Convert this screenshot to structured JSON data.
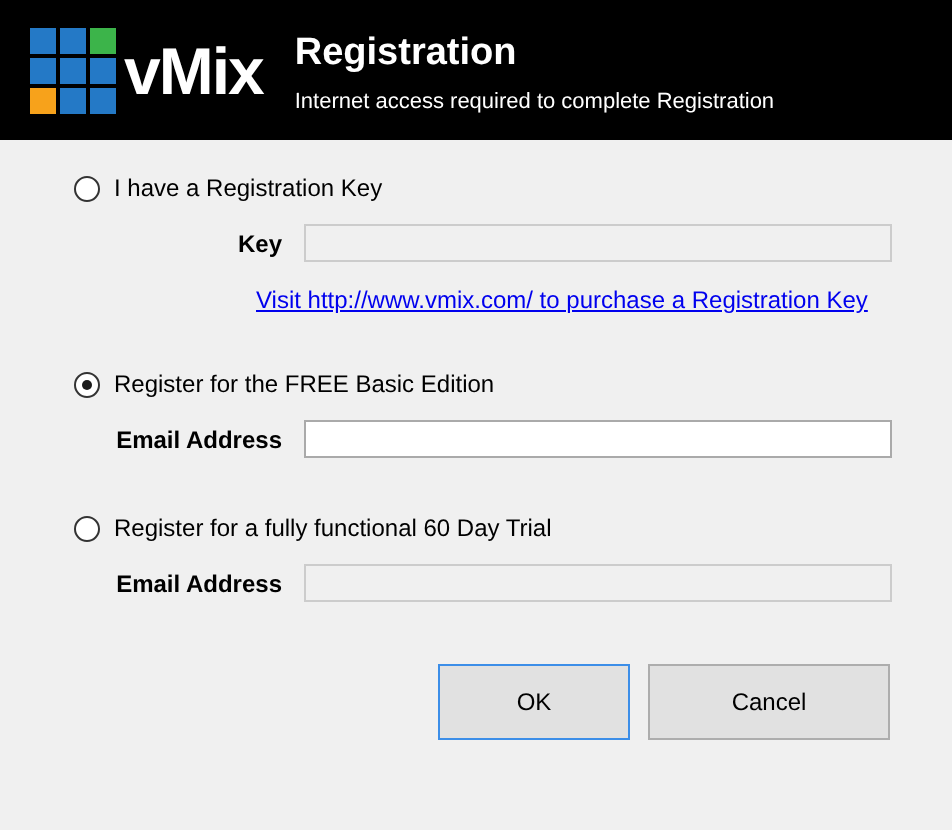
{
  "header": {
    "logo_text": "vMix",
    "title": "Registration",
    "subtitle": "Internet access required to complete Registration"
  },
  "options": [
    {
      "label": "I have a Registration Key",
      "selected": false,
      "field": {
        "label": "Key",
        "disabled": true
      },
      "link": "Visit http://www.vmix.com/ to purchase a Registration Key"
    },
    {
      "label": "Register for the FREE Basic Edition",
      "selected": true,
      "field": {
        "label": "Email Address",
        "disabled": false
      }
    },
    {
      "label": "Register for a fully functional 60 Day Trial",
      "selected": false,
      "field": {
        "label": "Email Address",
        "disabled": true
      }
    }
  ],
  "buttons": [
    {
      "label": "OK",
      "default": true
    },
    {
      "label": "Cancel",
      "default": false
    }
  ]
}
